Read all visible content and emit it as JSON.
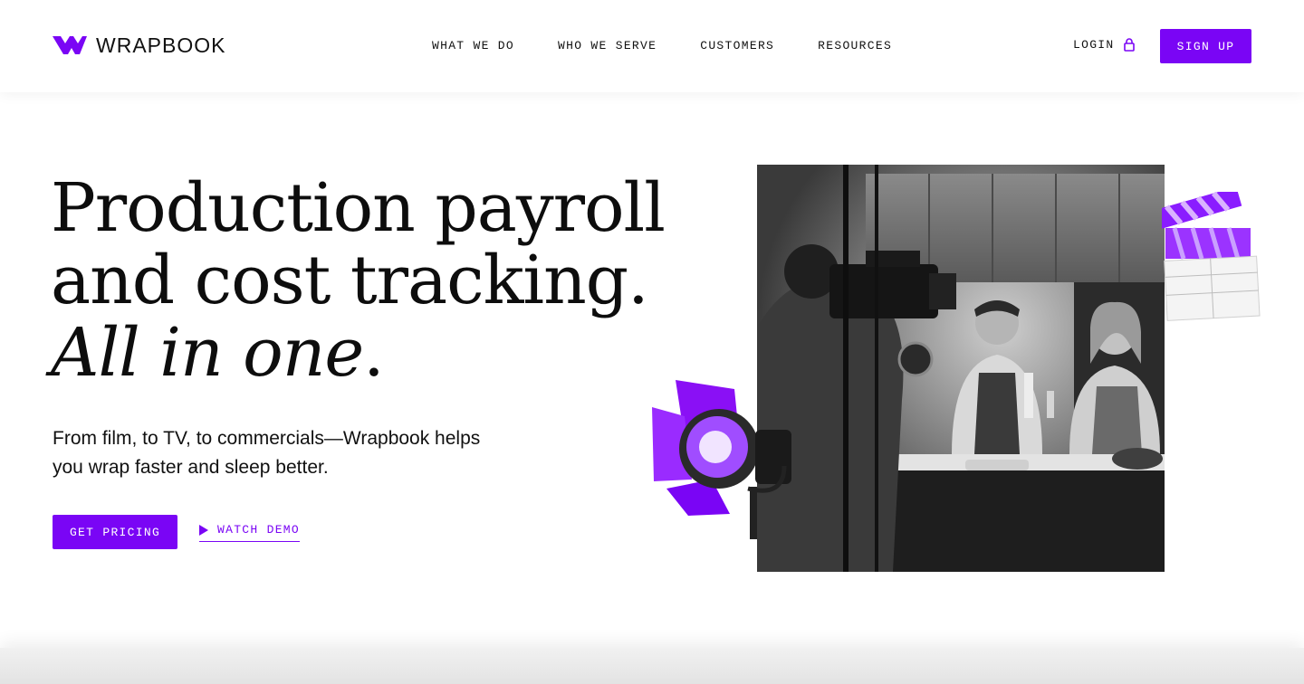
{
  "colors": {
    "brand_purple": "#7a05f5",
    "text": "#111111",
    "background": "#ffffff"
  },
  "header": {
    "logo_text": "WRAPBOOK",
    "nav": [
      {
        "label": "WHAT WE DO"
      },
      {
        "label": "WHO WE SERVE"
      },
      {
        "label": "CUSTOMERS"
      },
      {
        "label": "RESOURCES"
      }
    ],
    "login_label": "LOGIN",
    "login_icon": "lock-icon",
    "signup_label": "SIGN UP"
  },
  "hero": {
    "title_line1": "Production payroll",
    "title_line2": "and cost tracking.",
    "title_line3_italic": "All in one",
    "title_line3_period": ".",
    "subtitle": "From film, to TV, to commercials—Wrapbook helps you wrap faster and sleep better.",
    "cta_label": "GET PRICING",
    "watch_label": "WATCH DEMO",
    "watch_icon": "play-icon"
  }
}
